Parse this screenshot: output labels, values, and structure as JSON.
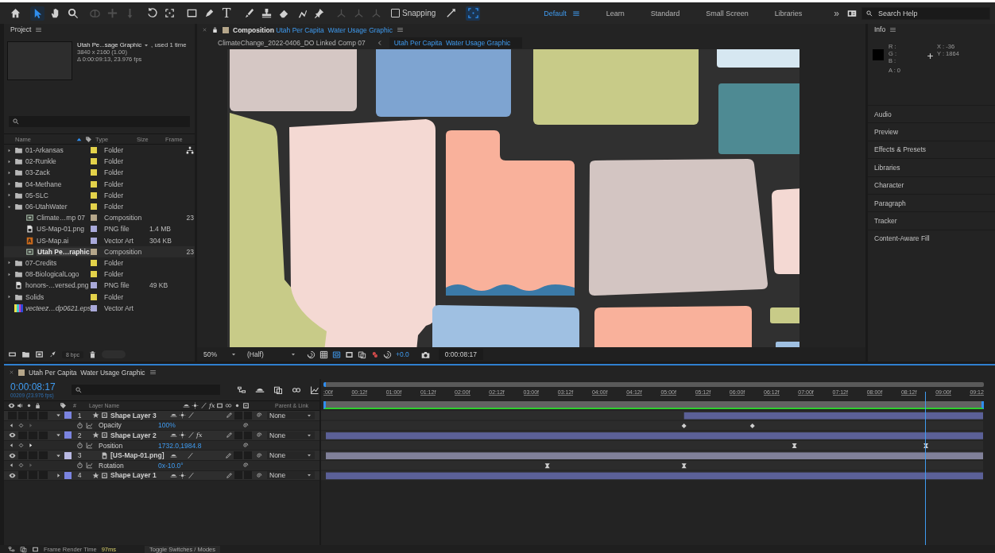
{
  "toolbar": {
    "tool_groups": [
      [
        {
          "kind": "home",
          "selected": false,
          "disabled": false
        }
      ],
      [
        {
          "kind": "selection",
          "selected": true,
          "disabled": false
        },
        {
          "kind": "hand",
          "selected": false,
          "disabled": false
        },
        {
          "kind": "zoom",
          "selected": false,
          "disabled": false
        }
      ],
      [
        {
          "kind": "orbit",
          "selected": false,
          "disabled": true
        },
        {
          "kind": "pan",
          "selected": false,
          "disabled": true
        },
        {
          "kind": "dolly",
          "selected": false,
          "disabled": true
        }
      ],
      [
        {
          "kind": "rotate",
          "selected": false,
          "disabled": false
        },
        {
          "kind": "anchor",
          "selected": false,
          "disabled": false
        }
      ],
      [
        {
          "kind": "rectangle",
          "selected": false,
          "disabled": false
        },
        {
          "kind": "pen",
          "selected": false,
          "disabled": false
        },
        {
          "kind": "text",
          "glyph": "T",
          "selected": false,
          "disabled": false
        }
      ],
      [
        {
          "kind": "brush",
          "selected": false,
          "disabled": false
        },
        {
          "kind": "stamp",
          "selected": false,
          "disabled": false
        },
        {
          "kind": "eraser",
          "selected": false,
          "disabled": false
        },
        {
          "kind": "roto",
          "selected": false,
          "disabled": false
        },
        {
          "kind": "puppet",
          "selected": false,
          "disabled": false
        }
      ]
    ],
    "axis_tools": [
      {
        "disabled": true
      },
      {
        "disabled": true
      },
      {
        "disabled": true
      }
    ],
    "snapping": {
      "label": "Snapping",
      "checked": false
    },
    "snap_tools": [
      {
        "kind": "arrows",
        "selected": false
      },
      {
        "kind": "target",
        "selected": true
      }
    ],
    "workspaces": [
      {
        "label": "Default",
        "selected": true
      },
      {
        "label": "Learn",
        "selected": false
      },
      {
        "label": "Standard",
        "selected": false
      },
      {
        "label": "Small Screen",
        "selected": false
      },
      {
        "label": "Libraries",
        "selected": false
      }
    ],
    "overflow": "»",
    "search": {
      "placeholder": "Search Help"
    }
  },
  "project": {
    "title": "Project",
    "preview": {
      "name": "Utah Pe...sage Graphic",
      "usage": ", used 1 time",
      "size": "3840 x 2160 (1.00)",
      "duration": "Δ 0:00:09:13, 23.976 fps"
    },
    "columns": {
      "name": "Name",
      "type": "Type",
      "size": "Size",
      "frame_rate": "Frame"
    },
    "items": [
      {
        "name": "01-Arkansas",
        "kind": "folder",
        "color": "#e3d24a",
        "type": "Folder",
        "expanded": false,
        "selected": false
      },
      {
        "name": "02-Runkle",
        "kind": "folder",
        "color": "#e3d24a",
        "type": "Folder",
        "expanded": false,
        "selected": false
      },
      {
        "name": "03-Zack",
        "kind": "folder",
        "color": "#e3d24a",
        "type": "Folder",
        "expanded": false,
        "selected": false
      },
      {
        "name": "04-Methane",
        "kind": "folder",
        "color": "#e3d24a",
        "type": "Folder",
        "expanded": false,
        "selected": false
      },
      {
        "name": "05-SLC",
        "kind": "folder",
        "color": "#e3d24a",
        "type": "Folder",
        "expanded": false,
        "selected": false
      },
      {
        "name": "06-UtahWater",
        "kind": "folder",
        "color": "#e3d24a",
        "type": "Folder",
        "expanded": true,
        "selected": false,
        "children": [
          {
            "name": "Climate…mp 07",
            "kind": "composition",
            "color": "#b5a68a",
            "type": "Composition",
            "frame_rate": "23",
            "selected": false
          },
          {
            "name": "US-Map-01.png",
            "kind": "image",
            "color": "#a9a9d9",
            "type": "PNG file",
            "size": "1.4 MB",
            "selected": false
          },
          {
            "name": "US-Map.ai",
            "kind": "illustrator",
            "color": "#a9a9d9",
            "type": "Vector Art",
            "size": "304 KB",
            "selected": false
          },
          {
            "name": "Utah Pe…raphic",
            "kind": "composition",
            "color": "#b5a68a",
            "type": "Composition",
            "frame_rate": "23",
            "selected": true
          }
        ]
      },
      {
        "name": "07-Credits",
        "kind": "folder",
        "color": "#e3d24a",
        "type": "Folder",
        "expanded": false,
        "selected": false
      },
      {
        "name": "08-BiologicalLogo",
        "kind": "folder",
        "color": "#e3d24a",
        "type": "Folder",
        "expanded": false,
        "selected": false
      },
      {
        "name": "honors-…versed.png",
        "kind": "image",
        "color": "#a9a9d9",
        "type": "PNG file",
        "size": "49 KB",
        "selected": false
      },
      {
        "name": "Solids",
        "kind": "folder",
        "color": "#e3d24a",
        "type": "Folder",
        "expanded": false,
        "selected": false
      },
      {
        "name": "vecteez…dp0621.eps",
        "kind": "missing",
        "color": "#a9a9d9",
        "type": "Vector Art",
        "selected": false
      }
    ],
    "bpc": "8 bpc"
  },
  "composition": {
    "tab_label": "Composition",
    "name": "Utah Per Capita  Water Usage Graphic",
    "color": "#b5a68a",
    "breadcrumbs": [
      {
        "label": "ClimateChange_2022-0406_DO Linked Comp 07",
        "selected": false
      },
      {
        "label": "Utah Per Capita  Water Usage Graphic",
        "selected": true
      }
    ],
    "zoom": "50%",
    "resolution": "(Half)",
    "exposure": "+0.0",
    "time": "0:00:08:17"
  },
  "info": {
    "title": "Info",
    "channels": [
      "R :",
      "G :",
      "B :",
      "A : 0"
    ],
    "coords": [
      "X : -36",
      "Y : 1864"
    ]
  },
  "panels": [
    "Audio",
    "Preview",
    "Effects & Presets",
    "Libraries",
    "Character",
    "Paragraph",
    "Tracker",
    "Content-Aware Fill"
  ],
  "timeline": {
    "title": "Utah Per Capita  Water Usage Graphic",
    "color": "#b5a68a",
    "timecode": "0:00:08:17",
    "frame_info": "00209 (23.976 fps)",
    "columns": {
      "number": "#",
      "layer_name": "Layer Name",
      "fx": "fx",
      "parent": "Parent & Link"
    },
    "rows": [
      {
        "kind": "shape_layer",
        "number": "1",
        "name": "Shape Layer 3",
        "color": "#7b84e0",
        "visible": false,
        "expanded": true,
        "collapse": true,
        "parent": "None"
      },
      {
        "kind": "property",
        "name": "Opacity",
        "value": "100%",
        "has_next": false
      },
      {
        "kind": "shape_layer",
        "number": "2",
        "name": "Shape Layer 2",
        "color": "#7b84e0",
        "visible": true,
        "expanded": true,
        "collapse": true,
        "effects": "fx",
        "parent": "None"
      },
      {
        "kind": "property",
        "name": "Position",
        "value": "1732.0,1984.8",
        "has_next": true
      },
      {
        "kind": "footage_layer",
        "number": "3",
        "name": "[US-Map-01.png]",
        "color": "#b9b9e3",
        "visible": true,
        "expanded": true,
        "collapse": false,
        "parent": "None"
      },
      {
        "kind": "property",
        "name": "Rotation",
        "value": "0x-10.0°",
        "has_next": false
      },
      {
        "kind": "shape_layer",
        "number": "4",
        "name": "Shape Layer 1",
        "color": "#7b84e0",
        "visible": true,
        "expanded": false,
        "collapse": true,
        "parent": "None"
      }
    ],
    "ruler": [
      ":00f",
      "00:12f",
      "01:00f",
      "01:12f",
      "02:00f",
      "02:12f",
      "03:00f",
      "03:12f",
      "04:00f",
      "04:12f",
      "05:00f",
      "05:12f",
      "06:00f",
      "06:12f",
      "07:00f",
      "07:12f",
      "08:00f",
      "08:12f",
      "09:00f",
      "09:12"
    ],
    "playhead": {
      "level": 0.909
    }
  },
  "status": {
    "label": "Frame Render Time",
    "value": "97ms",
    "toggle": "Toggle Switches / Modes"
  }
}
